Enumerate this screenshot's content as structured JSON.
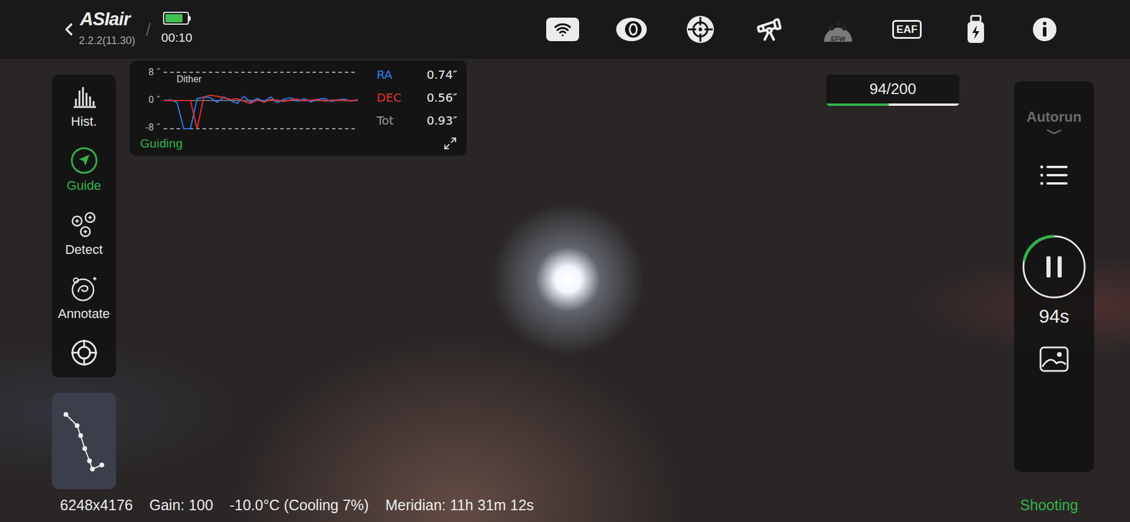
{
  "top_bar": {
    "logo": "ASIair",
    "version": "2.2.2(11.30)",
    "separator": "/",
    "battery_level": 0.8,
    "time": "00:10",
    "icons": [
      {
        "kind": "wifi",
        "label": "",
        "disabled": false
      },
      {
        "kind": "camera",
        "label": "",
        "disabled": false
      },
      {
        "kind": "guide",
        "label": "",
        "disabled": false
      },
      {
        "kind": "mount",
        "label": "",
        "disabled": false
      },
      {
        "kind": "efw",
        "label": "EFW",
        "disabled": true
      },
      {
        "kind": "eaf",
        "label": "EAF",
        "disabled": false
      },
      {
        "kind": "usb",
        "label": "",
        "disabled": false
      },
      {
        "kind": "info",
        "label": "",
        "disabled": false
      }
    ]
  },
  "tools": [
    {
      "label": "Hist.",
      "selected": false
    },
    {
      "label": "Guide",
      "selected": true
    },
    {
      "label": "Detect",
      "selected": false
    },
    {
      "label": "Annotate",
      "selected": false
    },
    {
      "label": "",
      "selected": false
    }
  ],
  "guide_graph": {
    "y_ticks": [
      "8 ″",
      "0 ″",
      "-8 ″"
    ],
    "y_max": 8,
    "marker": "Dither",
    "status": "Guiding",
    "series": [
      {
        "name": "RA",
        "value": "0.74″",
        "color": "#2f7bf5",
        "values": [
          0,
          0.2,
          -0.5,
          -8,
          -8,
          0.5,
          1,
          0.8,
          -0.5,
          1,
          0,
          -0.8,
          1.2,
          -0.5,
          0.6,
          -0.3,
          1,
          -0.6,
          0.4,
          0.8,
          -0.2,
          0.5,
          -0.4,
          0.3,
          0.6,
          -0.3,
          0.2,
          0.4,
          -0.2,
          0.3
        ]
      },
      {
        "name": "DEC",
        "value": "0.56″",
        "color": "#e8302d",
        "values": [
          0,
          0,
          0,
          0,
          0,
          -8,
          1,
          1.5,
          1.2,
          0.8,
          0.3,
          0.5,
          -0.2,
          -0.8,
          0.2,
          -0.5,
          0.3,
          0.1,
          -0.3,
          0.2,
          0.4,
          -0.1,
          0.1,
          0.3,
          -0.2,
          0.1,
          0.2,
          0,
          -0.1,
          0.1
        ]
      }
    ],
    "total": {
      "name": "Tot",
      "value": "0.93″"
    }
  },
  "progress": {
    "text": "94/200",
    "level": 0.47
  },
  "autorun": {
    "label": "Autorun",
    "disabled": true,
    "remaining": "94s",
    "level": 0.22,
    "running": true
  },
  "status_bar": {
    "items": [
      "6248x4176",
      "Gain: 100",
      "-10.0°C (Cooling 7%)",
      "Meridian: 11h 31m 12s"
    ],
    "state": "Shooting"
  }
}
